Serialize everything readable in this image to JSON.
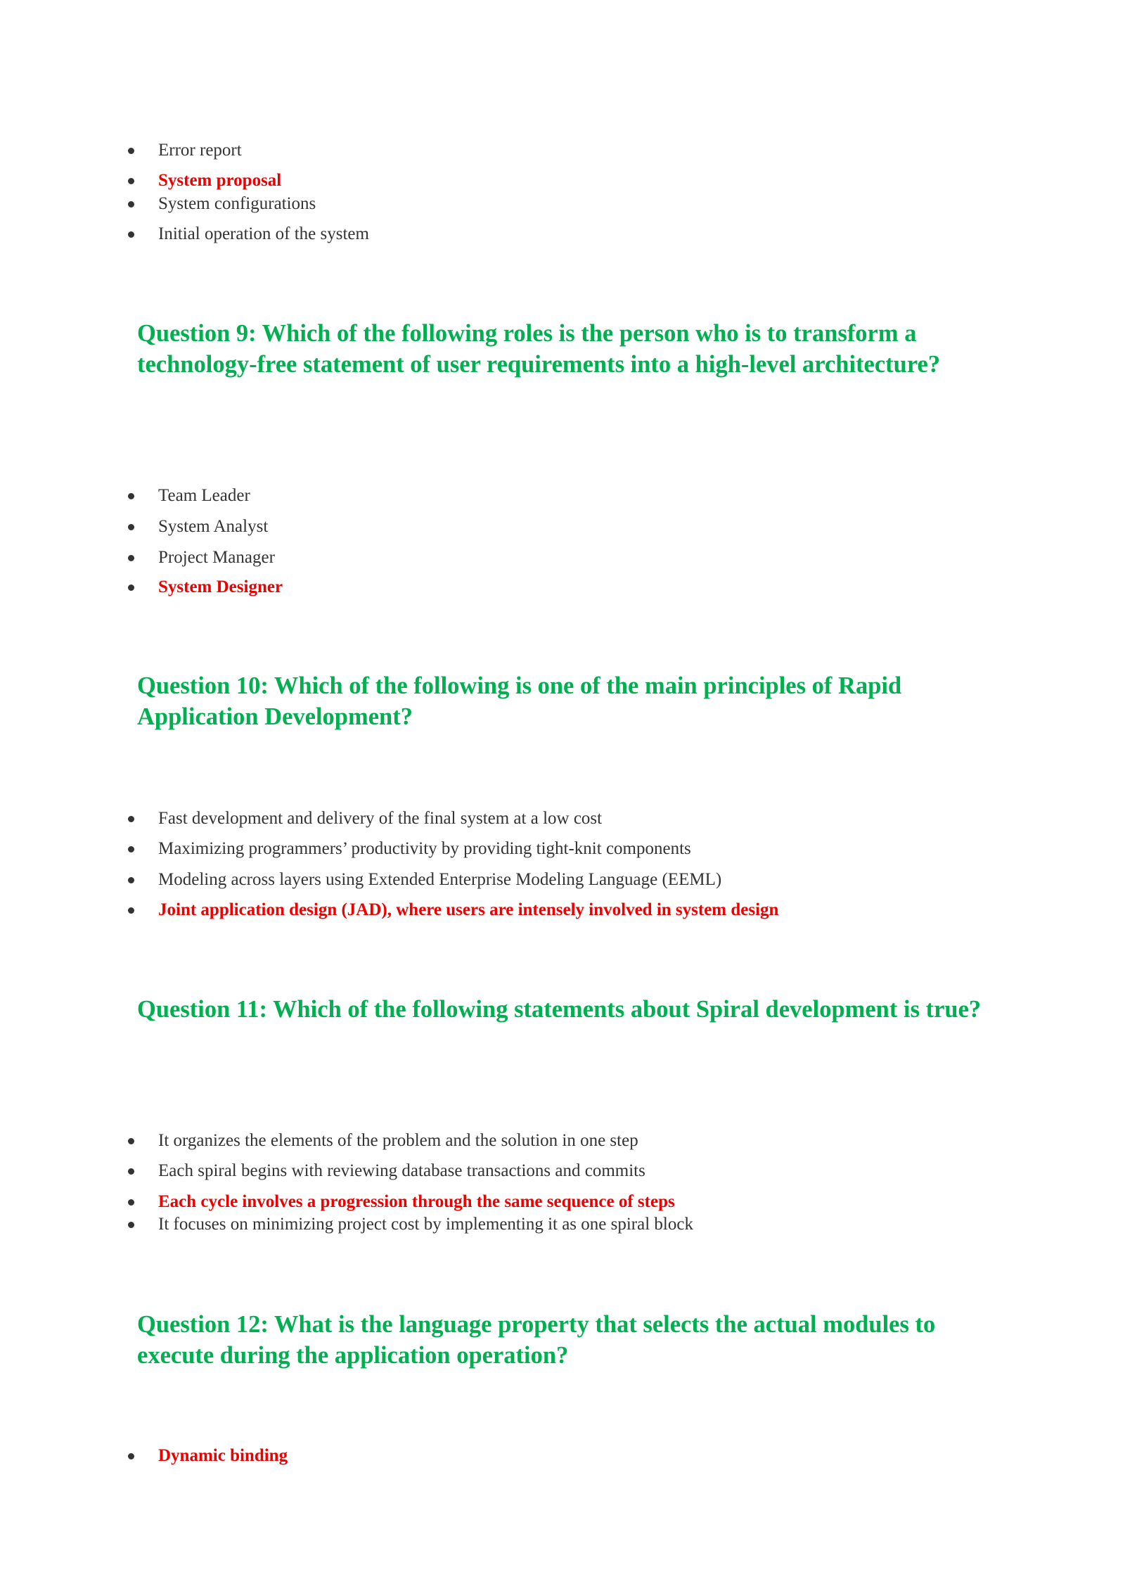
{
  "colors": {
    "question": "#00b050",
    "correct_answer": "#ee0000",
    "option": "#333333"
  },
  "prev_question_options": [
    {
      "text": "Error report",
      "correct": false
    },
    {
      "text": "System proposal",
      "correct": true
    },
    {
      "text": "System configurations",
      "correct": false
    },
    {
      "text": "Initial operation of the system",
      "correct": false
    }
  ],
  "questions": [
    {
      "title": "Question 9: Which of the following roles is the person who is to transform a technology-free statement of user requirements into a high-level architecture?",
      "options": [
        {
          "text": "Team Leader",
          "correct": false
        },
        {
          "text": "System Analyst",
          "correct": false
        },
        {
          "text": "Project Manager",
          "correct": false
        },
        {
          "text": "System Designer",
          "correct": true
        }
      ]
    },
    {
      "title": "Question 10: Which of the following is one of the main principles of Rapid Application Development?",
      "options": [
        {
          "text": "Fast development and delivery of the final system at a low cost",
          "correct": false
        },
        {
          "text": "Maximizing programmers’ productivity by providing tight-knit components",
          "correct": false
        },
        {
          "text": "Modeling across layers using Extended Enterprise Modeling Language (EEML)",
          "correct": false
        },
        {
          "text": "Joint application design (JAD), where users are intensely involved in system design",
          "correct": true
        }
      ]
    },
    {
      "title": "Question 11: Which of the following statements about Spiral development is true?",
      "options": [
        {
          "text": "It organizes the elements of the problem and the solution in one step",
          "correct": false
        },
        {
          "text": "Each spiral begins with reviewing database transactions and commits",
          "correct": false
        },
        {
          "text": "Each cycle involves a progression through the same sequence of steps",
          "correct": true
        },
        {
          "text": "It focuses on minimizing project cost by implementing it as one spiral block",
          "correct": false
        }
      ]
    },
    {
      "title": "Question 12: What is the language property that selects the actual modules to execute during the application operation?",
      "options": [
        {
          "text": "Dynamic binding",
          "correct": true
        }
      ]
    }
  ]
}
